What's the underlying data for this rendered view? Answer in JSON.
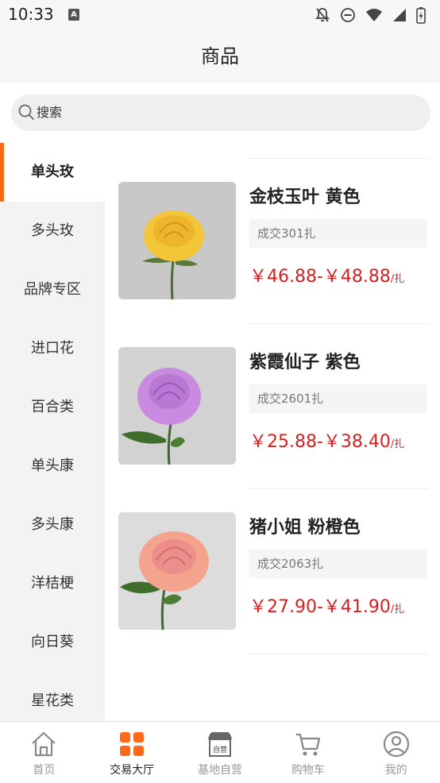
{
  "status_bar": {
    "time": "10:33",
    "notification_letter": "A"
  },
  "header": {
    "title": "商品"
  },
  "search": {
    "placeholder": "搜索"
  },
  "sidebar": {
    "items": [
      {
        "label": "单头玫",
        "active": true
      },
      {
        "label": "多头玫"
      },
      {
        "label": "品牌专区"
      },
      {
        "label": "进口花"
      },
      {
        "label": "百合类"
      },
      {
        "label": "单头康"
      },
      {
        "label": "多头康"
      },
      {
        "label": "洋桔梗"
      },
      {
        "label": "向日葵"
      },
      {
        "label": "星花类"
      }
    ]
  },
  "products": [
    {
      "name": "金枝玉叶 黄色",
      "sold": "成交301扎",
      "price": "￥46.88-￥48.88",
      "unit": "/扎",
      "flower_color": "#f3c63a",
      "flower_shade": "#e6a81f"
    },
    {
      "name": "紫霞仙子 紫色",
      "sold": "成交2601扎",
      "price": "￥25.88-￥38.40",
      "unit": "/扎",
      "flower_color": "#c98be0",
      "flower_shade": "#a765c8"
    },
    {
      "name": "猪小姐 粉橙色",
      "sold": "成交2063扎",
      "price": "￥27.90-￥41.90",
      "unit": "/扎",
      "flower_color": "#f4a48c",
      "flower_shade": "#e4788a"
    }
  ],
  "tabbar": {
    "tabs": [
      {
        "label": "首页",
        "icon": "home-icon"
      },
      {
        "label": "交易大厅",
        "icon": "grid-icon",
        "active": true
      },
      {
        "label": "基地自营",
        "icon": "store-icon",
        "badge": "自营"
      },
      {
        "label": "购物车",
        "icon": "cart-icon"
      },
      {
        "label": "我的",
        "icon": "user-icon"
      }
    ]
  },
  "colors": {
    "accent": "#ff6a1a",
    "price": "#d81e1e"
  }
}
